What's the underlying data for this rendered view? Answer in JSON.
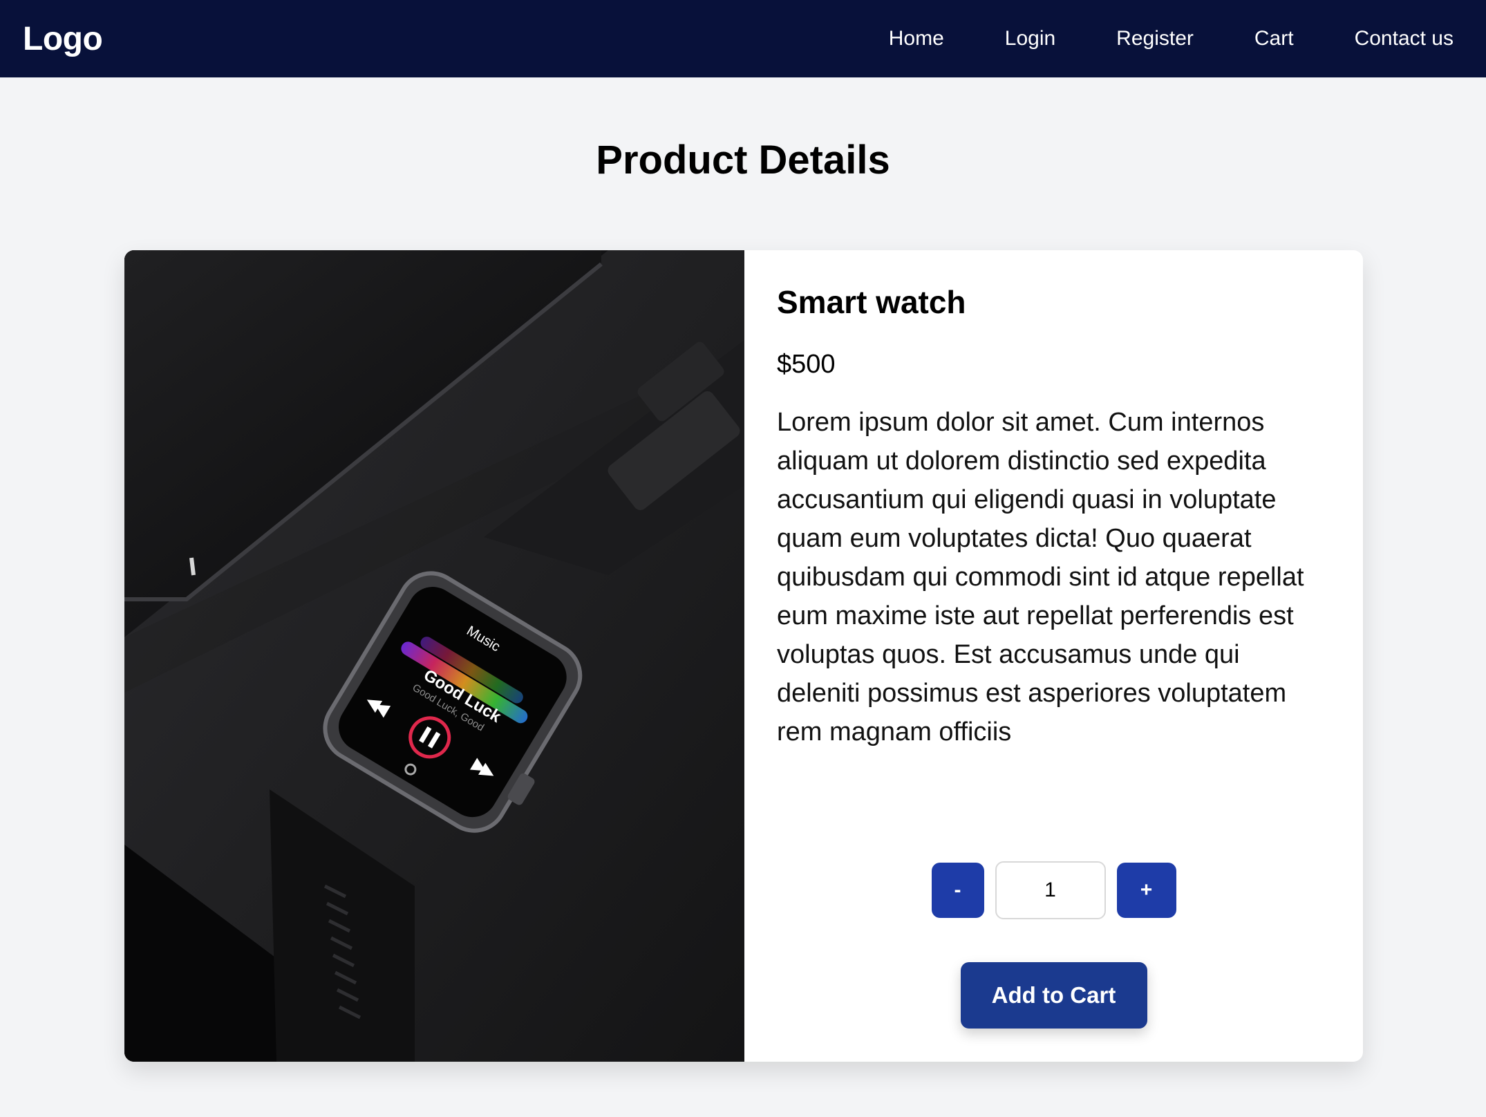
{
  "header": {
    "logo": "Logo",
    "nav": [
      {
        "label": "Home"
      },
      {
        "label": "Login"
      },
      {
        "label": "Register"
      },
      {
        "label": "Cart"
      },
      {
        "label": "Contact us"
      }
    ],
    "background_color": "#08113a"
  },
  "page": {
    "title": "Product Details"
  },
  "product": {
    "name": "Smart watch",
    "price": "$500",
    "description": "Lorem ipsum dolor sit amet. Cum internos aliquam ut dolorem distinctio sed expedita accusantium qui eligendi quasi in voluptate quam eum voluptates dicta! Quo quaerat quibusdam qui commodi sint id atque repellat eum maxime iste aut repellat perferendis est voluptas quos. Est accusamus unde qui deleniti possimus est asperiores voluptatem rem magnam officiis",
    "image": {
      "screen_title": "Music",
      "screen_song": "Good Luck",
      "screen_subtitle": "Good Luck, Good"
    }
  },
  "quantity": {
    "decrement_label": "-",
    "value": "1",
    "increment_label": "+"
  },
  "actions": {
    "add_to_cart_label": "Add to Cart"
  },
  "colors": {
    "accent": "#1e3ca8",
    "add_to_cart": "#1b3a8f",
    "page_background": "#f3f4f6"
  }
}
